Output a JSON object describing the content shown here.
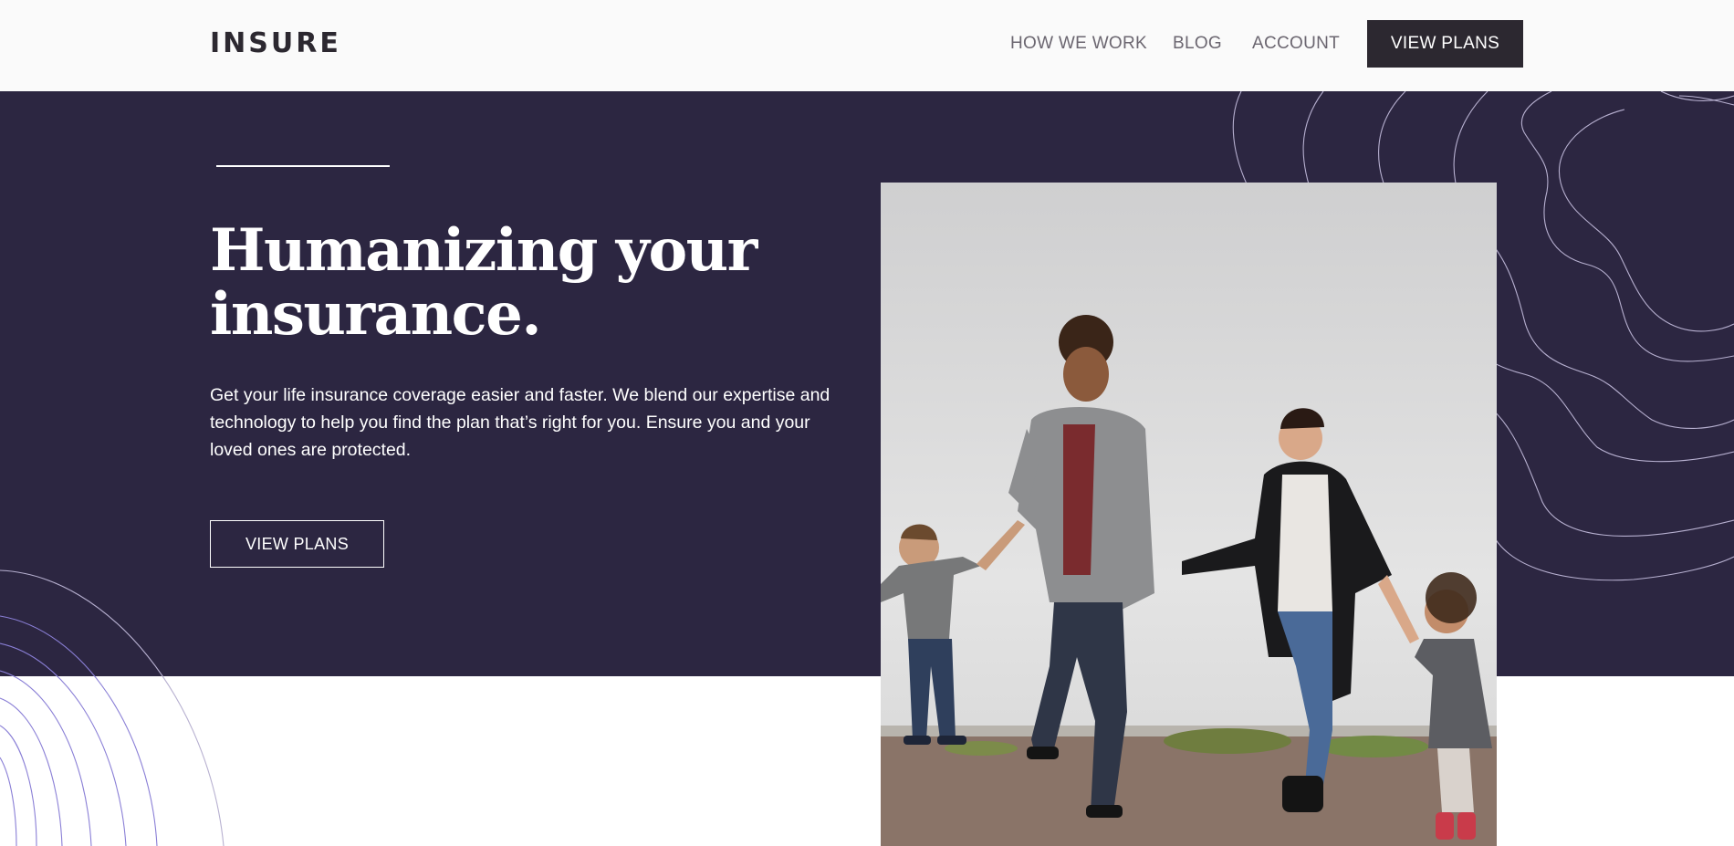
{
  "header": {
    "logo": "INSURE",
    "nav": {
      "how_we_work": "HOW WE WORK",
      "blog": "BLOG",
      "account": "ACCOUNT"
    },
    "cta_label": "VIEW PLANS"
  },
  "hero": {
    "title": "Humanizing your insurance.",
    "description": "Get your life insurance coverage easier and faster. We blend our expertise and technology to help you find the plan that’s right for you. Ensure you and your loved ones are protected.",
    "cta_label": "VIEW PLANS"
  },
  "colors": {
    "hero_background": "#2c2641",
    "header_background": "#fafafa",
    "dark_button": "#2c2830",
    "pattern_light": "#b7b0d0",
    "pattern_violet": "#8a7fd6"
  },
  "icons": {
    "photo": "family-walking-photo"
  }
}
